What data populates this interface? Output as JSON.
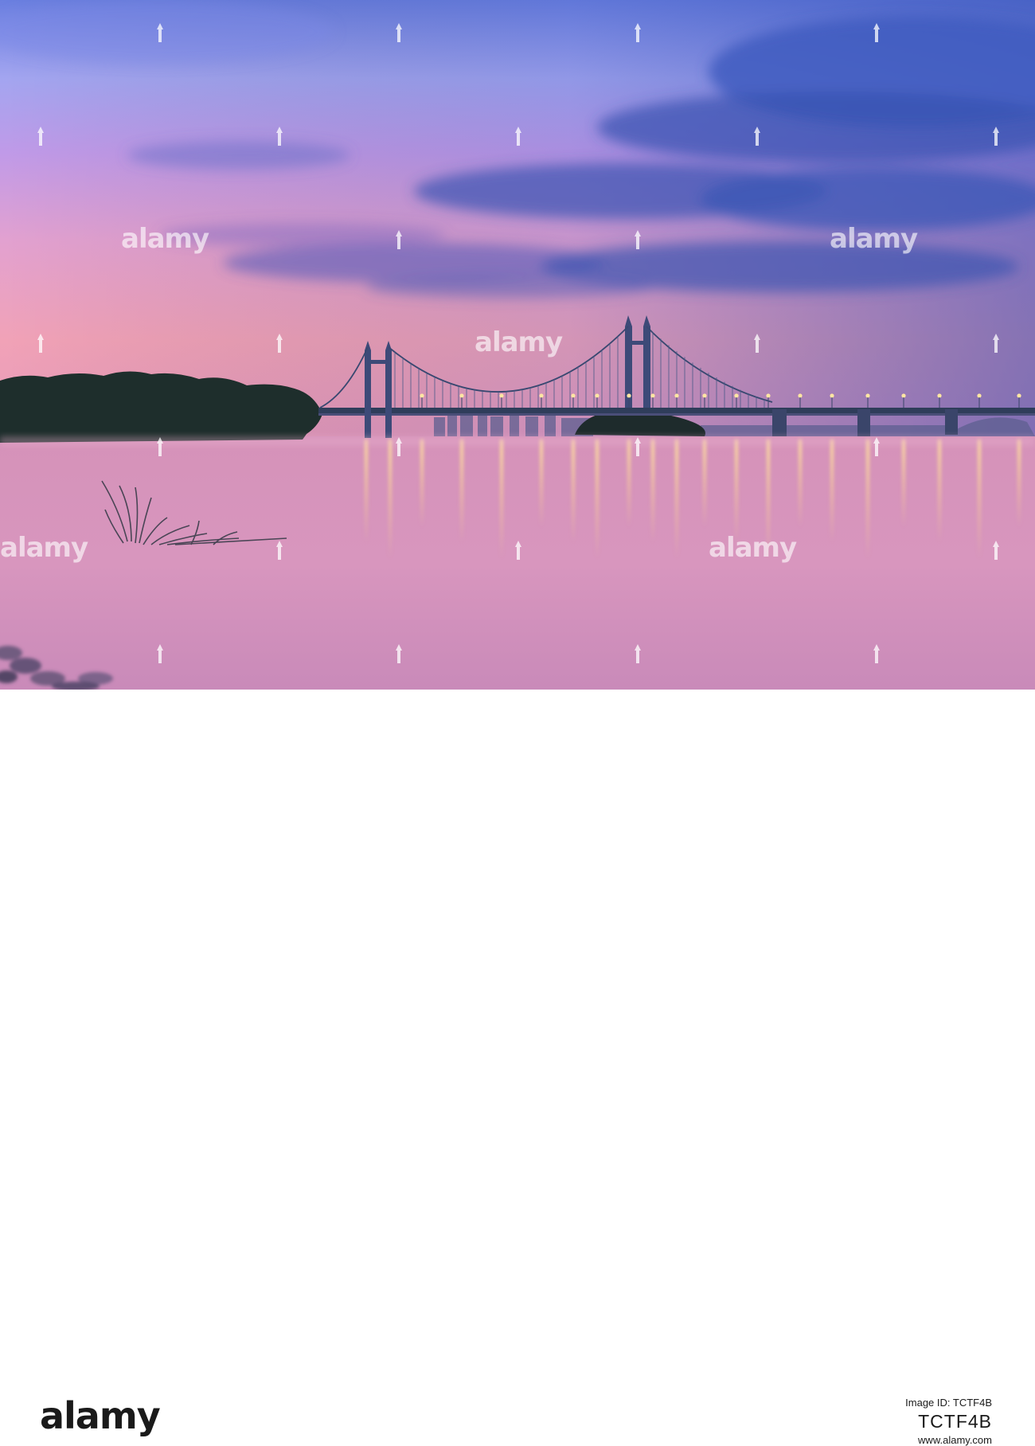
{
  "photo": {
    "subject": "suspension bridge over a lake at dusk",
    "colors": {
      "sky_top": "#5b6fd6",
      "sky_mid": "#b78fe6",
      "sky_horizon": "#f1a3bb",
      "water": "#d390b8",
      "clouds": "#3a55a8",
      "silhouette": "#1f2a3a",
      "lights": "#ffd98a"
    }
  },
  "watermark": {
    "text": "alamy"
  },
  "footer": {
    "logo": "alamy",
    "image_id_label": "Image ID: TCTF4B",
    "image_id": "TCTF4B",
    "url": "www.alamy.com"
  }
}
